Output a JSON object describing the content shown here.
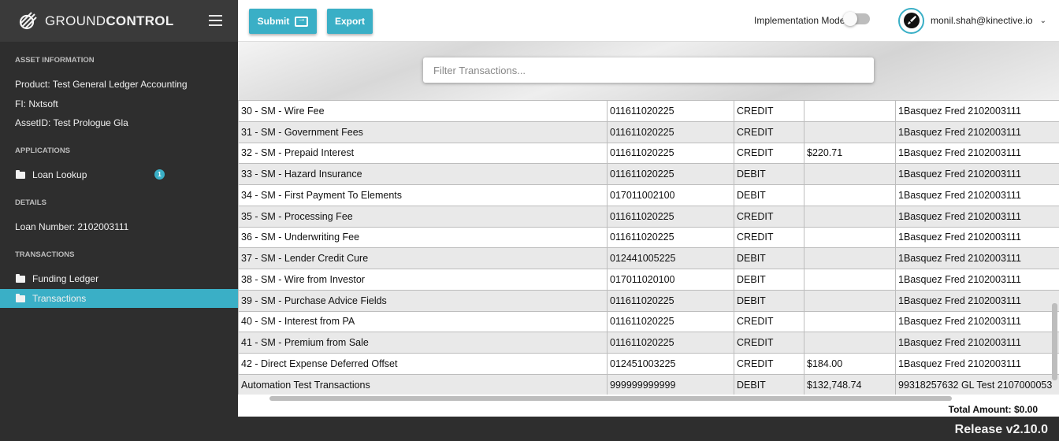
{
  "brand": {
    "prefix": "GROUND",
    "suffix": "CONTROL"
  },
  "sidebar": {
    "asset_title": "ASSET INFORMATION",
    "product": "Product:  Test General Ledger Accounting",
    "fi": "FI:  Nxtsoft",
    "asset_id": "AssetID:  Test Prologue Gla",
    "applications_title": "APPLICATIONS",
    "loan_lookup": "Loan Lookup",
    "loan_lookup_badge": "1",
    "details_title": "DETAILS",
    "loan_number": "Loan Number:  2102003111",
    "transactions_title": "TRANSACTIONS",
    "funding_ledger": "Funding Ledger",
    "transactions": "Transactions"
  },
  "toolbar": {
    "submit_label": "Submit",
    "export_label": "Export",
    "implementation_mode_label": "Implementation Mode",
    "implementation_mode_on": false,
    "user_email": "monil.shah@kinective.io"
  },
  "filter": {
    "placeholder": "Filter Transactions..."
  },
  "table": {
    "rows": [
      [
        "30 - SM - Wire Fee",
        "011611020225",
        "CREDIT",
        "",
        "1Basquez Fred 2102003111"
      ],
      [
        "31 - SM - Government Fees",
        "011611020225",
        "CREDIT",
        "",
        "1Basquez Fred 2102003111"
      ],
      [
        "32 - SM - Prepaid Interest",
        "011611020225",
        "CREDIT",
        "$220.71",
        "1Basquez Fred 2102003111"
      ],
      [
        "33 - SM - Hazard Insurance",
        "011611020225",
        "DEBIT",
        "",
        "1Basquez Fred 2102003111"
      ],
      [
        "34 - SM - First Payment To Elements",
        "017011002100",
        "DEBIT",
        "",
        "1Basquez Fred 2102003111"
      ],
      [
        "35 - SM - Processing Fee",
        "011611020225",
        "CREDIT",
        "",
        "1Basquez Fred 2102003111"
      ],
      [
        "36 - SM - Underwriting Fee",
        "011611020225",
        "CREDIT",
        "",
        "1Basquez Fred 2102003111"
      ],
      [
        "37 - SM - Lender Credit Cure",
        "012441005225",
        "DEBIT",
        "",
        "1Basquez Fred 2102003111"
      ],
      [
        "38 - SM - Wire from Investor",
        "017011020100",
        "DEBIT",
        "",
        "1Basquez Fred 2102003111"
      ],
      [
        "39 - SM - Purchase Advice Fields",
        "011611020225",
        "DEBIT",
        "",
        "1Basquez Fred 2102003111"
      ],
      [
        "40 - SM - Interest from PA",
        "011611020225",
        "CREDIT",
        "",
        "1Basquez Fred 2102003111"
      ],
      [
        "41 - SM - Premium from Sale",
        "011611020225",
        "CREDIT",
        "",
        "1Basquez Fred 2102003111"
      ],
      [
        "42 - Direct Expense Deferred Offset",
        "012451003225",
        "CREDIT",
        "$184.00",
        "1Basquez Fred 2102003111"
      ],
      [
        "Automation Test Transactions",
        "999999999999",
        "DEBIT",
        "$132,748.74",
        "99318257632 GL Test 2107000053"
      ]
    ]
  },
  "total": "Total Amount: $0.00",
  "release": "Release v2.10.0",
  "colors": {
    "accent": "#3aafc6",
    "sidebar": "#2e2e2e"
  }
}
